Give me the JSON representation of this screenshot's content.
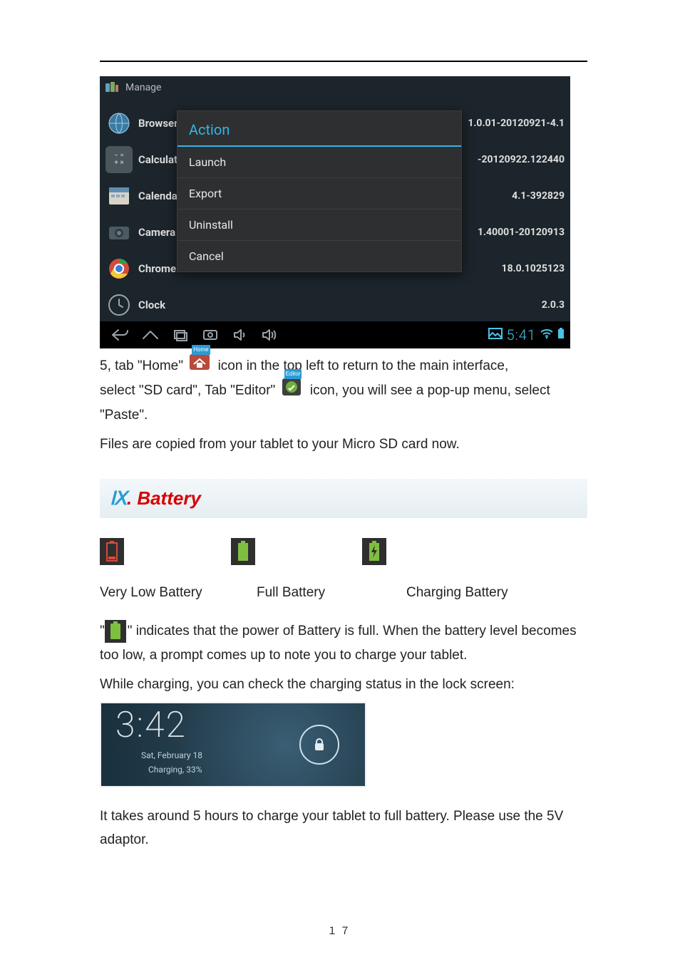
{
  "android": {
    "title": "Manage",
    "apps": [
      {
        "name": "Browser",
        "version": "1.0.01-20120921-4.1"
      },
      {
        "name": "Calculator",
        "version": "-20120922.122440"
      },
      {
        "name": "Calendar",
        "version": "4.1-392829"
      },
      {
        "name": "Camera",
        "version": "1.40001-20120913"
      },
      {
        "name": "Chrome",
        "version": "18.0.1025123"
      },
      {
        "name": "Clock",
        "version": "2.0.3"
      }
    ],
    "popup": {
      "title": "Action",
      "items": [
        "Launch",
        "Export",
        "Uninstall",
        "Cancel"
      ]
    },
    "navbar_time": "5:41"
  },
  "home_caption": "Home",
  "editor_caption": "Editor",
  "para1_a": "5, tab \"Home\"",
  "para1_b": " icon in the top left to return to the main interface,",
  "para2_a": "select \"SD card\", Tab \"Editor\" ",
  "para2_b": " icon, you will see a pop-up menu, select \"Paste\".",
  "para3": "Files are copied from your tablet to your Micro SD card now.",
  "section": {
    "num": "Ⅸ",
    "dot": ". ",
    "title": "Battery"
  },
  "battery_labels": {
    "low": "Very Low Battery",
    "full": "Full Battery",
    "charging": "Charging Battery"
  },
  "para4": "\" indicates that the power of Battery is full. When the battery level becomes too low, a prompt comes up to note you to charge your tablet.",
  "para5": "While charging, you can check the charging status in the lock screen:",
  "lock": {
    "time": "3:42",
    "date": "Sat, February 18",
    "status": "Charging, 33%"
  },
  "para6": "It takes around 5 hours to charge your tablet to full battery. Please use the 5V adaptor.",
  "page_number": "１７"
}
